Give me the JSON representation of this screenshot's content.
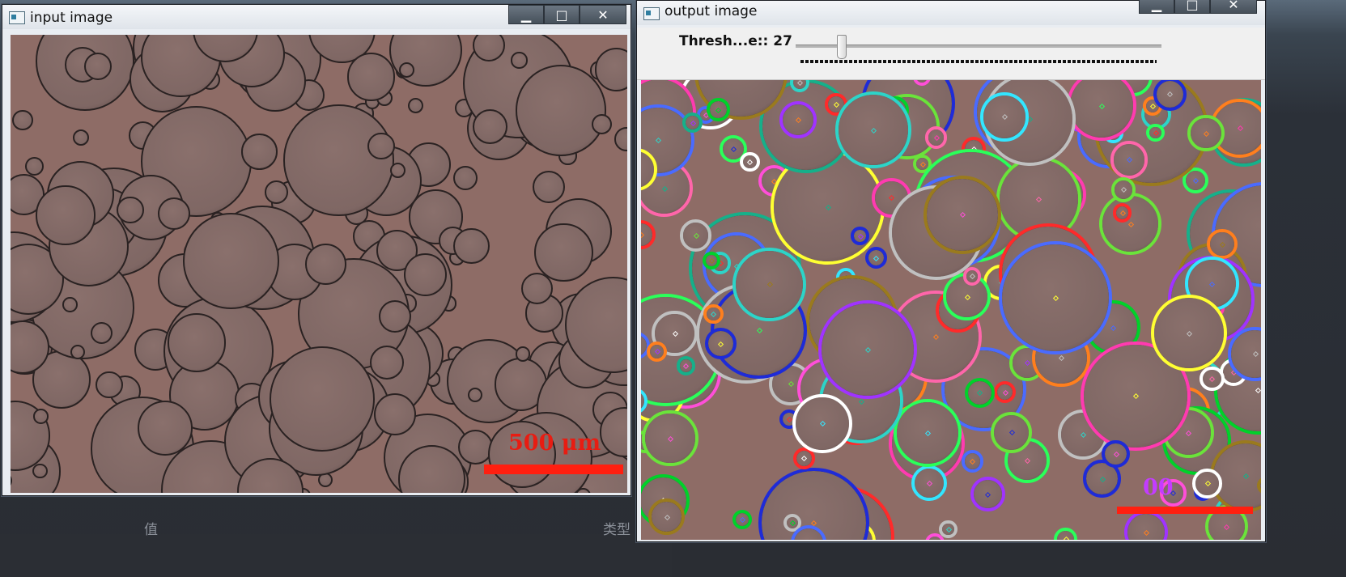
{
  "left_window": {
    "title": "input image",
    "scale_label": "500 μm"
  },
  "right_window": {
    "title": "output image",
    "trackbar_label": "Thresh...e:: 27",
    "trackbar_value": 27,
    "scale_label_partial": "00"
  },
  "window_controls": {
    "minimize": "▁",
    "maximize": "□",
    "close": "✕"
  },
  "background": {
    "label_left": "值",
    "label_right": "类型"
  },
  "colors": {
    "scale_bar": "#ff1f10",
    "particle_bg": "#8e6c66",
    "contour_palette": [
      "#00d12a",
      "#ff4fd8",
      "#2bff5a",
      "#1e2bd8",
      "#ffff33",
      "#ff2a2a",
      "#33e6ff",
      "#a033ff",
      "#ff7f1e",
      "#ffffff",
      "#16b08a",
      "#ff66aa",
      "#4a6bff",
      "#6be33b",
      "#c0c0c0",
      "#ff3bb0",
      "#2dd4c8",
      "#9a7a1e"
    ]
  }
}
